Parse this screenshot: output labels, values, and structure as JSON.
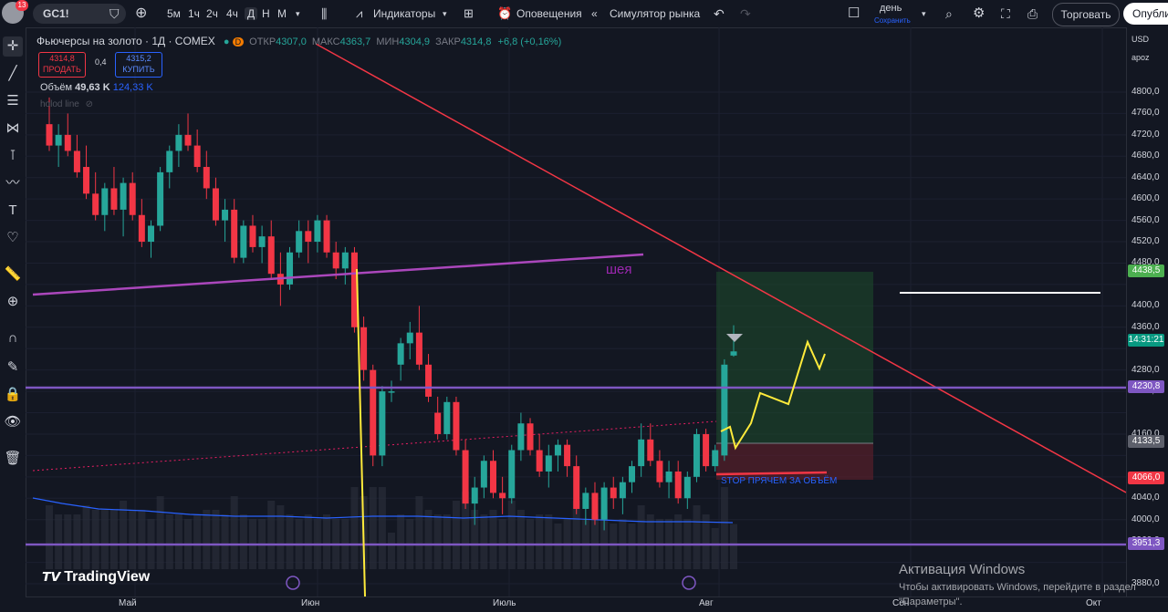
{
  "topbar": {
    "badge": "13",
    "symbol": "GC1!",
    "timeframes": [
      "5м",
      "1ч",
      "2ч",
      "4ч",
      "Д",
      "Н",
      "М"
    ],
    "indicators": "Индикаторы",
    "alerts": "Оповещения",
    "replay": "Симулятор рынка",
    "layout_name": "день",
    "layout_sub": "Сохранить",
    "trade": "Торговать",
    "publish": "Опубли"
  },
  "legend": {
    "title": "Фьючерсы на золото · 1Д · COMEX",
    "open_label": "ОТКР",
    "open": "4307,0",
    "high_label": "МАКС",
    "high": "4363,7",
    "low_label": "МИН",
    "low": "4304,9",
    "close_label": "ЗАКР",
    "close": "4314,8",
    "change": "+6,8 (+0,16%)",
    "sell_price": "4314,8",
    "sell_label": "ПРОДАТЬ",
    "spread": "0,4",
    "buy_price": "4315,2",
    "buy_label": "КУПИТЬ",
    "volume_label": "Объём",
    "volume": "49,63 K",
    "volume_ma": "124,33 K",
    "indicator_name": "holod line"
  },
  "price_axis": {
    "currency": "USD",
    "unit": "apoz",
    "labels": [
      "4800,0",
      "4760,0",
      "4720,0",
      "4680,0",
      "4640,0",
      "4600,0",
      "4560,0",
      "4520,0",
      "4480,0",
      "4400,0",
      "4360,0",
      "4280,0",
      "4240,0",
      "4160,0",
      "4080,0",
      "4040,0",
      "4000,0",
      "3960,0",
      "3880,0"
    ],
    "tags": [
      {
        "text": "4438,5",
        "color": "#4caf50",
        "fg": "#ffffff"
      },
      {
        "text": "14:31:21",
        "color": "#089981",
        "fg": "#ffffff"
      },
      {
        "text": "4230,8",
        "color": "#7e57c2",
        "fg": "#ffffff"
      },
      {
        "text": "4133,5",
        "color": "#5d606b",
        "fg": "#ffffff"
      },
      {
        "text": "4066,0",
        "color": "#f23645",
        "fg": "#ffffff"
      },
      {
        "text": "3951,3",
        "color": "#7e57c2",
        "fg": "#ffffff"
      }
    ]
  },
  "time_axis": [
    "Май",
    "Июн",
    "Июль",
    "Авг",
    "Сен",
    "Окт"
  ],
  "annotations": {
    "neck": "шея",
    "stop": "STOP ПРЯЧЕМ ЗА ОБЪЁМ"
  },
  "logo": "TradingView",
  "windows_activation": {
    "title": "Активация Windows",
    "line1": "Чтобы активировать Windows, перейдите в раздел",
    "line2": "\"Параметры\"."
  },
  "chart_data": {
    "type": "candlestick",
    "title": "Фьючерсы на золото · 1Д · COMEX",
    "ylim": [
      3880,
      4800
    ],
    "candles": [
      {
        "o": 4740,
        "h": 4790,
        "l": 4690,
        "c": 4700
      },
      {
        "o": 4700,
        "h": 4740,
        "l": 4660,
        "c": 4720
      },
      {
        "o": 4720,
        "h": 4760,
        "l": 4680,
        "c": 4690
      },
      {
        "o": 4690,
        "h": 4720,
        "l": 4640,
        "c": 4650
      },
      {
        "o": 4660,
        "h": 4700,
        "l": 4600,
        "c": 4610
      },
      {
        "o": 4610,
        "h": 4650,
        "l": 4560,
        "c": 4570
      },
      {
        "o": 4570,
        "h": 4630,
        "l": 4540,
        "c": 4620
      },
      {
        "o": 4620,
        "h": 4660,
        "l": 4570,
        "c": 4580
      },
      {
        "o": 4580,
        "h": 4640,
        "l": 4530,
        "c": 4630
      },
      {
        "o": 4630,
        "h": 4650,
        "l": 4560,
        "c": 4570
      },
      {
        "o": 4570,
        "h": 4600,
        "l": 4510,
        "c": 4520
      },
      {
        "o": 4520,
        "h": 4560,
        "l": 4490,
        "c": 4550
      },
      {
        "o": 4550,
        "h": 4660,
        "l": 4540,
        "c": 4650
      },
      {
        "o": 4650,
        "h": 4700,
        "l": 4620,
        "c": 4690
      },
      {
        "o": 4690,
        "h": 4740,
        "l": 4660,
        "c": 4720
      },
      {
        "o": 4720,
        "h": 4760,
        "l": 4690,
        "c": 4700
      },
      {
        "o": 4700,
        "h": 4730,
        "l": 4650,
        "c": 4660
      },
      {
        "o": 4660,
        "h": 4690,
        "l": 4600,
        "c": 4620
      },
      {
        "o": 4620,
        "h": 4640,
        "l": 4550,
        "c": 4560
      },
      {
        "o": 4560,
        "h": 4600,
        "l": 4520,
        "c": 4580
      },
      {
        "o": 4580,
        "h": 4600,
        "l": 4480,
        "c": 4490
      },
      {
        "o": 4490,
        "h": 4560,
        "l": 4480,
        "c": 4550
      },
      {
        "o": 4550,
        "h": 4570,
        "l": 4500,
        "c": 4510
      },
      {
        "o": 4510,
        "h": 4550,
        "l": 4480,
        "c": 4530
      },
      {
        "o": 4530,
        "h": 4560,
        "l": 4450,
        "c": 4460
      },
      {
        "o": 4460,
        "h": 4500,
        "l": 4400,
        "c": 4440
      },
      {
        "o": 4440,
        "h": 4510,
        "l": 4430,
        "c": 4500
      },
      {
        "o": 4500,
        "h": 4560,
        "l": 4490,
        "c": 4540
      },
      {
        "o": 4540,
        "h": 4560,
        "l": 4480,
        "c": 4520
      },
      {
        "o": 4520,
        "h": 4570,
        "l": 4500,
        "c": 4560
      },
      {
        "o": 4560,
        "h": 4570,
        "l": 4490,
        "c": 4500
      },
      {
        "o": 4500,
        "h": 4520,
        "l": 4450,
        "c": 4470
      },
      {
        "o": 4470,
        "h": 4510,
        "l": 4440,
        "c": 4500
      },
      {
        "o": 4500,
        "h": 4510,
        "l": 4350,
        "c": 4360
      },
      {
        "o": 4360,
        "h": 4380,
        "l": 4260,
        "c": 4280
      },
      {
        "o": 4280,
        "h": 4290,
        "l": 4100,
        "c": 4120
      },
      {
        "o": 4120,
        "h": 4250,
        "l": 4100,
        "c": 4240
      },
      {
        "o": 4240,
        "h": 4260,
        "l": 4220,
        "c": 4240
      },
      {
        "o": 4290,
        "h": 4340,
        "l": 4260,
        "c": 4330
      },
      {
        "o": 4330,
        "h": 4370,
        "l": 4300,
        "c": 4350
      },
      {
        "o": 4350,
        "h": 4400,
        "l": 4280,
        "c": 4290
      },
      {
        "o": 4290,
        "h": 4310,
        "l": 4220,
        "c": 4230
      },
      {
        "o": 4200,
        "h": 4230,
        "l": 4150,
        "c": 4160
      },
      {
        "o": 4160,
        "h": 4230,
        "l": 4150,
        "c": 4220
      },
      {
        "o": 4220,
        "h": 4230,
        "l": 4120,
        "c": 4130
      },
      {
        "o": 4130,
        "h": 4150,
        "l": 4020,
        "c": 4030
      },
      {
        "o": 4030,
        "h": 4080,
        "l": 3990,
        "c": 4060
      },
      {
        "o": 4060,
        "h": 4120,
        "l": 4040,
        "c": 4110
      },
      {
        "o": 4110,
        "h": 4130,
        "l": 4040,
        "c": 4050
      },
      {
        "o": 4050,
        "h": 4080,
        "l": 4010,
        "c": 4040
      },
      {
        "o": 4040,
        "h": 4140,
        "l": 4030,
        "c": 4130
      },
      {
        "o": 4130,
        "h": 4200,
        "l": 4110,
        "c": 4180
      },
      {
        "o": 4180,
        "h": 4190,
        "l": 4120,
        "c": 4130
      },
      {
        "o": 4130,
        "h": 4160,
        "l": 4080,
        "c": 4090
      },
      {
        "o": 4090,
        "h": 4140,
        "l": 4060,
        "c": 4120
      },
      {
        "o": 4120,
        "h": 4150,
        "l": 4090,
        "c": 4140
      },
      {
        "o": 4140,
        "h": 4150,
        "l": 4080,
        "c": 4100
      },
      {
        "o": 4100,
        "h": 4120,
        "l": 4010,
        "c": 4020
      },
      {
        "o": 4020,
        "h": 4060,
        "l": 3990,
        "c": 4050
      },
      {
        "o": 4050,
        "h": 4070,
        "l": 3990,
        "c": 4000
      },
      {
        "o": 4000,
        "h": 4070,
        "l": 3980,
        "c": 4060
      },
      {
        "o": 4060,
        "h": 4080,
        "l": 4020,
        "c": 4040
      },
      {
        "o": 4040,
        "h": 4080,
        "l": 4010,
        "c": 4070
      },
      {
        "o": 4070,
        "h": 4110,
        "l": 4050,
        "c": 4100
      },
      {
        "o": 4100,
        "h": 4180,
        "l": 4080,
        "c": 4150
      },
      {
        "o": 4150,
        "h": 4180,
        "l": 4100,
        "c": 4110
      },
      {
        "o": 4110,
        "h": 4130,
        "l": 4060,
        "c": 4070
      },
      {
        "o": 4070,
        "h": 4110,
        "l": 4040,
        "c": 4090
      },
      {
        "o": 4090,
        "h": 4110,
        "l": 4030,
        "c": 4040
      },
      {
        "o": 4040,
        "h": 4090,
        "l": 4020,
        "c": 4080
      },
      {
        "o": 4080,
        "h": 4170,
        "l": 4070,
        "c": 4160
      },
      {
        "o": 4160,
        "h": 4170,
        "l": 4090,
        "c": 4100
      },
      {
        "o": 4100,
        "h": 4140,
        "l": 4090,
        "c": 4130
      },
      {
        "o": 4120,
        "h": 4300,
        "l": 4110,
        "c": 4290
      },
      {
        "o": 4307,
        "h": 4363.7,
        "l": 4304.9,
        "c": 4314.8
      }
    ]
  }
}
